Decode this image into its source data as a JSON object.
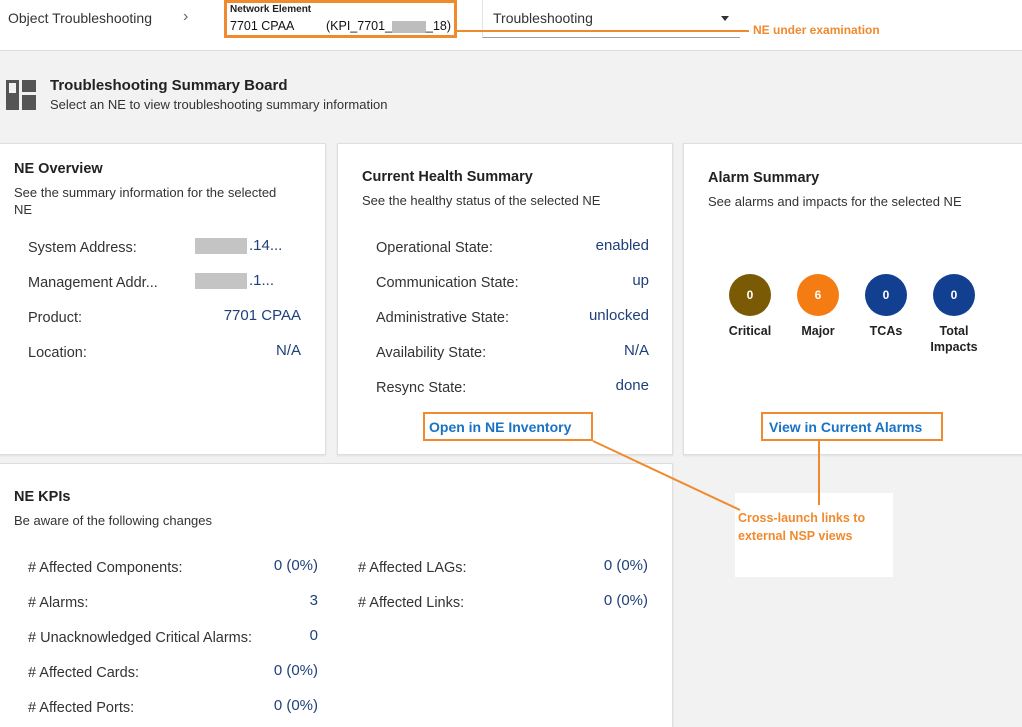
{
  "topbar": {
    "breadcrumb": "Object Troubleshooting",
    "ne_label": "Network Element",
    "ne_value": "7701 CPAA",
    "ne_kpi_prefix": "(KPI_7701_",
    "ne_kpi_suffix": "_18)",
    "view_select": "Troubleshooting",
    "callout": "NE under examination"
  },
  "board": {
    "title": "Troubleshooting Summary Board",
    "subtitle": "Select an NE to view troubleshooting summary information"
  },
  "ne_overview": {
    "title": "NE Overview",
    "subtitle_line1": "See the summary information for the selected",
    "subtitle_line2": "NE",
    "rows": [
      {
        "label": "System Address:",
        "value": ".14..."
      },
      {
        "label": "Management Addr...",
        "value": ".1..."
      },
      {
        "label": "Product:",
        "value": "7701 CPAA"
      },
      {
        "label": "Location:",
        "value": "N/A"
      }
    ]
  },
  "health": {
    "title": "Current Health Summary",
    "subtitle": "See the healthy status of the selected NE",
    "rows": [
      {
        "label": "Operational State:",
        "value": "enabled"
      },
      {
        "label": "Communication State:",
        "value": "up"
      },
      {
        "label": "Administrative State:",
        "value": "unlocked"
      },
      {
        "label": "Availability State:",
        "value": "N/A"
      },
      {
        "label": "Resync State:",
        "value": "done"
      }
    ],
    "link": "Open in NE Inventory"
  },
  "alarms": {
    "title": "Alarm Summary",
    "subtitle": "See alarms and impacts for the selected NE",
    "items": [
      {
        "count": "0",
        "label": "Critical",
        "color": "#7a5a05"
      },
      {
        "count": "6",
        "label": "Major",
        "color": "#f57c12"
      },
      {
        "count": "0",
        "label": "TCAs",
        "color": "#123f8f"
      },
      {
        "count": "0",
        "label_line1": "Total",
        "label_line2": "Impacts",
        "color": "#123f8f"
      }
    ],
    "link": "View in Current Alarms"
  },
  "kpis": {
    "title": "NE KPIs",
    "subtitle": "Be aware of the following changes",
    "left": [
      {
        "label": "# Affected Components:",
        "value": "0 (0%)"
      },
      {
        "label": "# Alarms:",
        "value": "3"
      },
      {
        "label": "# Unacknowledged Critical Alarms:",
        "value": "0"
      },
      {
        "label": "# Affected Cards:",
        "value": "0 (0%)"
      },
      {
        "label": "# Affected Ports:",
        "value": "0 (0%)"
      }
    ],
    "right": [
      {
        "label": "# Affected LAGs:",
        "value": "0 (0%)"
      },
      {
        "label": "# Affected Links:",
        "value": "0 (0%)"
      }
    ]
  },
  "callout_links_line1": "Cross-launch links to",
  "callout_links_line2": "external NSP views",
  "colors": {
    "accent": "#f08a2e",
    "link": "#1a72c4",
    "value": "#1f3f7a"
  }
}
